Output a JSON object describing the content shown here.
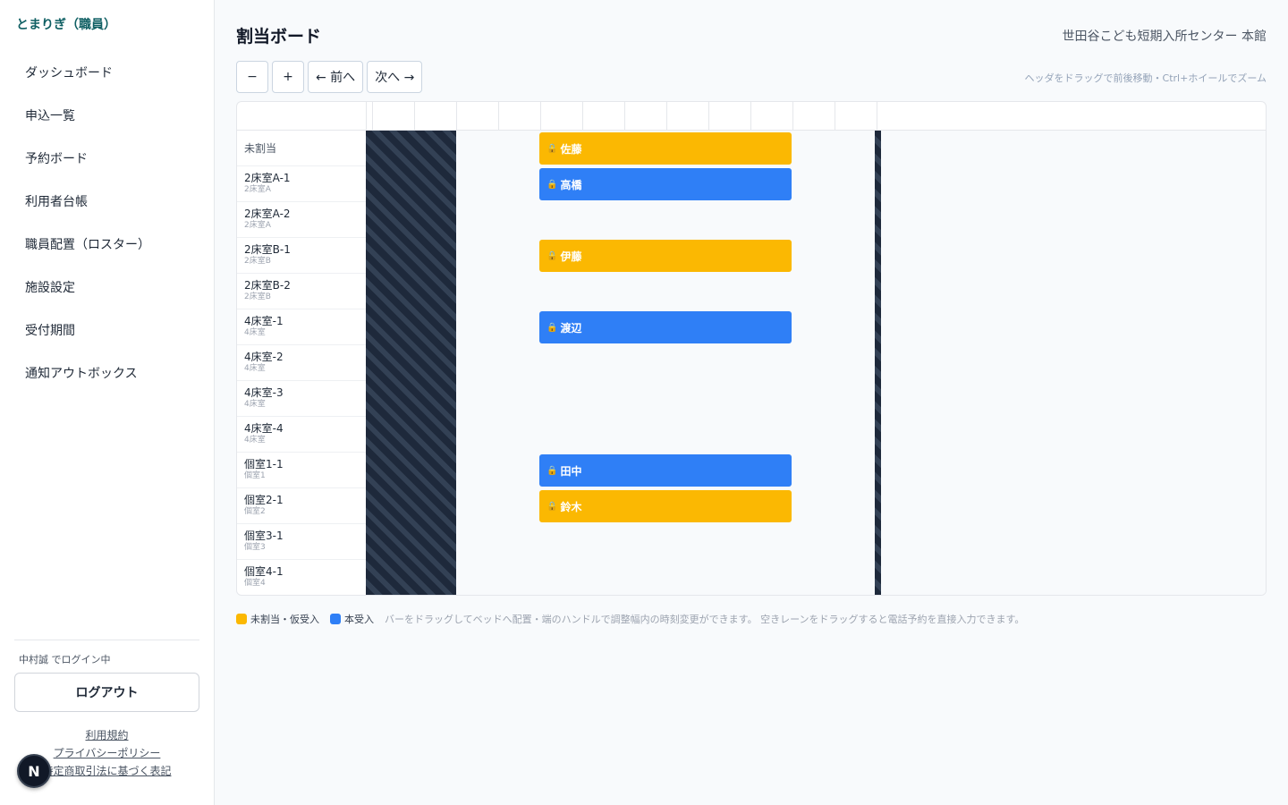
{
  "sidebar": {
    "brand": "とまりぎ（職員）",
    "nav": [
      "ダッシュボード",
      "申込一覧",
      "予約ボード",
      "利用者台帳",
      "職員配置（ロスター）",
      "施設設定",
      "受付期間",
      "通知アウトボックス"
    ],
    "login_text": "中村誠 でログイン中",
    "logout_label": "ログアウト",
    "footer_links": [
      "利用規約",
      "プライバシーポリシー",
      "特定商取引法に基づく表記"
    ],
    "badge": "N"
  },
  "header": {
    "title": "割当ボード",
    "facility": "世田谷こども短期入所センター 本館",
    "hint": "ヘッダをドラッグで前後移動・Ctrl+ホイールでズーム"
  },
  "toolbar": {
    "zoom_out": "−",
    "zoom_in": "+",
    "prev": "← 前へ",
    "next": "次へ →"
  },
  "rows": [
    {
      "name": "未割当",
      "sub": ""
    },
    {
      "name": "2床室A-1",
      "sub": "2床室A"
    },
    {
      "name": "2床室A-2",
      "sub": "2床室A"
    },
    {
      "name": "2床室B-1",
      "sub": "2床室B"
    },
    {
      "name": "2床室B-2",
      "sub": "2床室B"
    },
    {
      "name": "4床室-1",
      "sub": "4床室"
    },
    {
      "name": "4床室-2",
      "sub": "4床室"
    },
    {
      "name": "4床室-3",
      "sub": "4床室"
    },
    {
      "name": "4床室-4",
      "sub": "4床室"
    },
    {
      "name": "個室1-1",
      "sub": "個室1"
    },
    {
      "name": "個室2-1",
      "sub": "個室2"
    },
    {
      "name": "個室3-1",
      "sub": "個室3"
    },
    {
      "name": "個室4-1",
      "sub": "個室4"
    }
  ],
  "bars": [
    {
      "name": "佐藤",
      "row": 0,
      "status": "tentative",
      "icon": "lock-icon"
    },
    {
      "name": "高橋",
      "row": 1,
      "status": "confirmed",
      "icon": "lock-icon"
    },
    {
      "name": "伊藤",
      "row": 3,
      "status": "tentative",
      "icon": "lock-icon"
    },
    {
      "name": "渡辺",
      "row": 5,
      "status": "confirmed",
      "icon": "lock-icon"
    },
    {
      "name": "田中",
      "row": 9,
      "status": "confirmed",
      "icon": "lock-icon"
    },
    {
      "name": "鈴木",
      "row": 10,
      "status": "tentative",
      "icon": "lock-icon"
    }
  ],
  "legend": {
    "tentative_label": "未割当・仮受入",
    "confirmed_label": "本受入",
    "note": "バーをドラッグしてベッドへ配置・端のハンドルで調整幅内の時刻変更ができます。 空きレーンをドラッグすると電話予約を直接入力できます。"
  },
  "colors": {
    "tentative": "#FBB802",
    "confirmed": "#2F7FF6",
    "brand": "#0F5F63"
  }
}
